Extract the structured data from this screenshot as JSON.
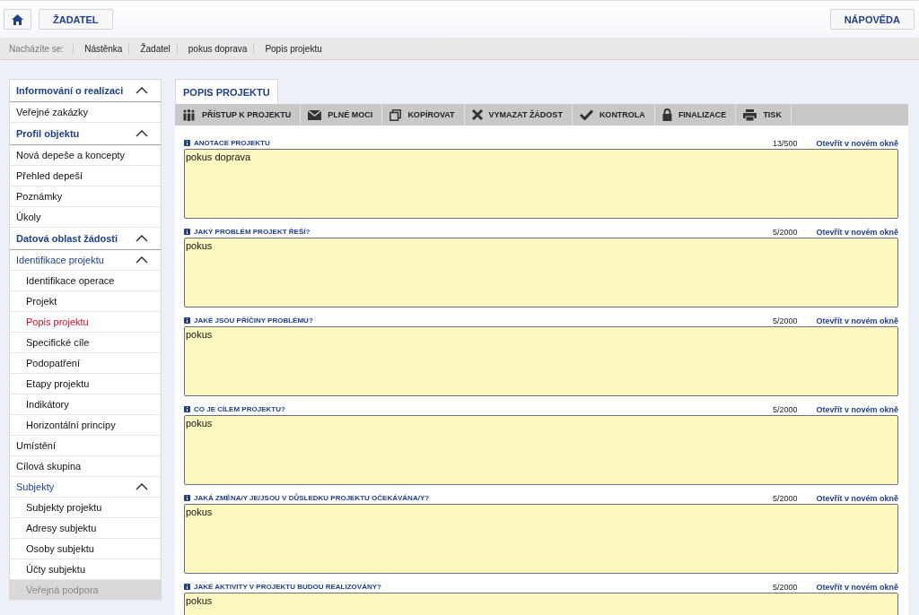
{
  "header": {
    "home_button": {
      "kind": "home"
    },
    "role_button": "ŽADATEL",
    "help_button": "NÁPOVĚDA"
  },
  "breadcrumb": {
    "label": "Nacházíte se:",
    "items": [
      "Nástěnka",
      "Žadatel",
      "pokus doprava",
      "Popis projektu"
    ]
  },
  "sidebar": {
    "items": [
      {
        "label": "Informování o realizaci",
        "expanded": true,
        "children": [
          {
            "label": "Veřejné zakázky",
            "selected": false,
            "disabled": false
          }
        ]
      },
      {
        "label": "Profil objektu",
        "expanded": true,
        "children": [
          {
            "label": "Nová depeše a koncepty",
            "selected": false,
            "disabled": false
          },
          {
            "label": "Přehled depeší",
            "selected": false,
            "disabled": false
          },
          {
            "label": "Poznámky",
            "selected": false,
            "disabled": false
          },
          {
            "label": "Úkoly",
            "selected": false,
            "disabled": false
          }
        ]
      },
      {
        "label": "Datová oblast žádosti",
        "expanded": true,
        "children": [
          {
            "label": "Identifikace projektu",
            "expanded": true,
            "children": [
              {
                "label": "Identifikace operace",
                "selected": false,
                "disabled": false
              },
              {
                "label": "Projekt",
                "selected": false,
                "disabled": false
              },
              {
                "label": "Popis projektu",
                "selected": true,
                "disabled": false
              },
              {
                "label": "Specifické cíle",
                "selected": false,
                "disabled": false
              },
              {
                "label": "Podopatření",
                "selected": false,
                "disabled": false
              },
              {
                "label": "Etapy projektu",
                "selected": false,
                "disabled": false
              },
              {
                "label": "Indikátory",
                "selected": false,
                "disabled": false
              },
              {
                "label": "Horizontální principy",
                "selected": false,
                "disabled": false
              }
            ]
          },
          {
            "label": "Umístění",
            "selected": false,
            "disabled": false
          },
          {
            "label": "Cílová skupina",
            "selected": false,
            "disabled": false
          },
          {
            "label": "Subjekty",
            "expanded": true,
            "children": [
              {
                "label": "Subjekty projektu",
                "selected": false,
                "disabled": false
              },
              {
                "label": "Adresy subjektu",
                "selected": false,
                "disabled": false
              },
              {
                "label": "Osoby subjektu",
                "selected": false,
                "disabled": false
              },
              {
                "label": "Účty subjektu",
                "selected": false,
                "disabled": false
              },
              {
                "label": "Veřejná podpora",
                "selected": false,
                "disabled": true
              }
            ]
          }
        ]
      }
    ]
  },
  "main": {
    "tab": "POPIS PROJEKTU",
    "toolbar": [
      "PŘÍSTUP K PROJEKTU",
      "PLNÉ MOCI",
      "KOPÍROVAT",
      "VYMAZAT ŽÁDOST",
      "KONTROLA",
      "FINALIZACE",
      "TISK"
    ],
    "fields": [
      {
        "label": "ANOTACE PROJEKTU",
        "counter": "13/500",
        "link": "Otevřít v novém okně",
        "value": "pokus doprava"
      },
      {
        "label": "JAKÝ PROBLÉM PROJEKT ŘEŠÍ?",
        "counter": "5/2000",
        "link": "Otevřít v novém okně",
        "value": "pokus"
      },
      {
        "label": "JAKÉ JSOU PŘÍČINY PROBLÉMU?",
        "counter": "5/2000",
        "link": "Otevřít v novém okně",
        "value": "pokus"
      },
      {
        "label": "CO JE CÍLEM PROJEKTU?",
        "counter": "5/2000",
        "link": "Otevřít v novém okně",
        "value": "pokus"
      },
      {
        "label": "JAKÁ ZMĚNA/Y JE/JSOU V DŮSLEDKU PROJEKTU OČEKÁVÁNA/Y?",
        "counter": "5/2000",
        "link": "Otevřít v novém okně",
        "value": "pokus"
      },
      {
        "label": "JAKÉ AKTIVITY V PROJEKTU BUDOU REALIZOVÁNY?",
        "counter": "5/2000",
        "link": "Otevřít v novém okně",
        "value": "pokus"
      }
    ]
  }
}
